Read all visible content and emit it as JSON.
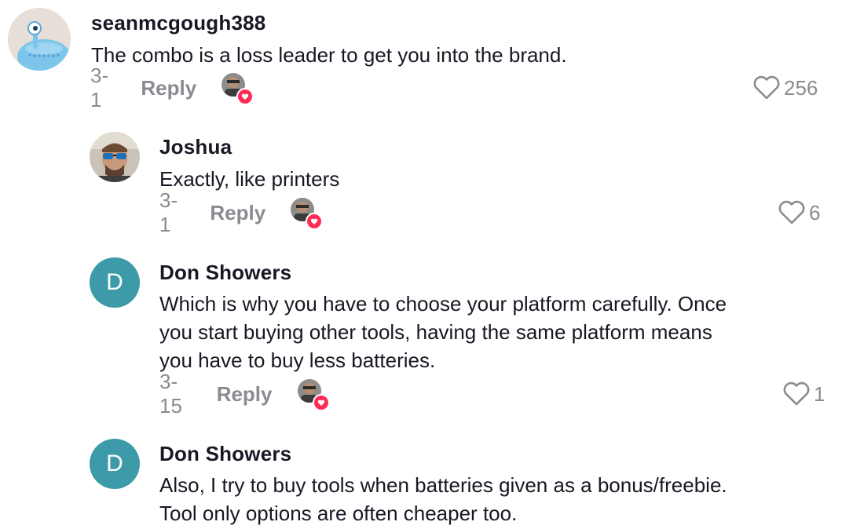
{
  "comments": [
    {
      "username": "seanmcgough388",
      "text_lines": [
        "The combo is a loss leader to get you into the brand."
      ],
      "date": "3-1",
      "reply_label": "Reply",
      "likes": "256",
      "avatar_icon": "cartoon-creature-avatar",
      "avatar_color": "#7ec5ec"
    },
    {
      "username": "Joshua",
      "text_lines": [
        "Exactly, like printers"
      ],
      "date": "3-1",
      "reply_label": "Reply",
      "likes": "6",
      "avatar_icon": "photo-avatar-sunglasses"
    },
    {
      "username": "Don Showers",
      "text_lines": [
        "Which is why you have to choose your platform carefully. Once",
        "you start buying other tools, having the same platform means",
        "you have to buy less batteries."
      ],
      "date": "3-15",
      "reply_label": "Reply",
      "likes": "1",
      "avatar_letter": "D",
      "avatar_color": "#3d9aa8"
    },
    {
      "username": "Don Showers",
      "text_lines": [
        "Also, I try to buy tools when batteries given as a bonus/freebie.",
        "Tool only options are often cheaper too."
      ],
      "avatar_letter": "D",
      "avatar_color": "#3d9aa8"
    }
  ],
  "colors": {
    "meta_text": "#8a8b91",
    "heart_badge": "#fe2c55",
    "text": "#161823"
  }
}
